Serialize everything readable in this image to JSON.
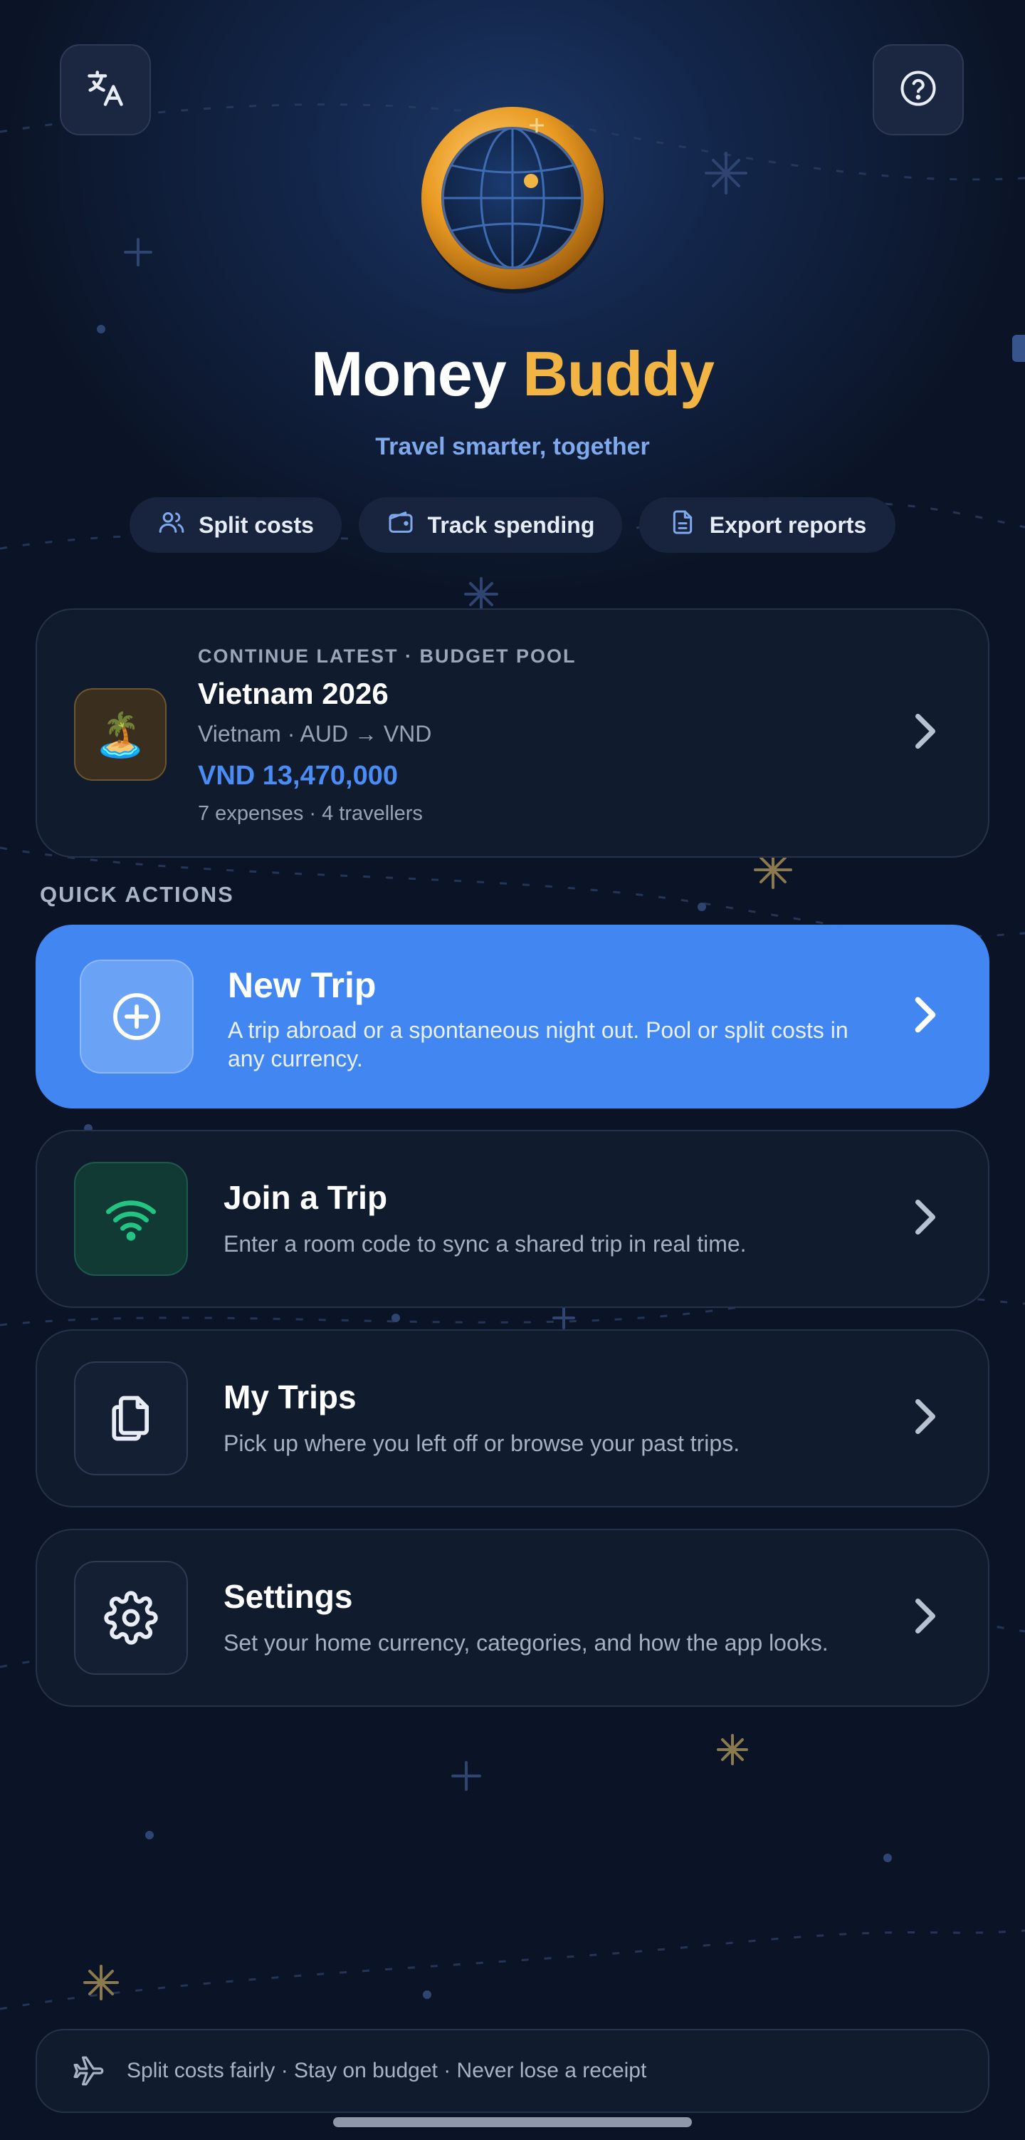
{
  "header": {
    "language_icon": "translate-icon",
    "help_icon": "help-circle-icon"
  },
  "brand": {
    "title_part1": "Money",
    "title_part2": "Buddy",
    "tagline": "Travel smarter, together",
    "logo_icon": "globe-coin-icon",
    "accent_color": "#f2b544"
  },
  "features": [
    {
      "label": "Split costs",
      "icon": "users-icon"
    },
    {
      "label": "Track spending",
      "icon": "wallet-icon"
    },
    {
      "label": "Export reports",
      "icon": "document-icon"
    }
  ],
  "continue_card": {
    "eyebrow": "CONTINUE LATEST · BUDGET POOL",
    "title": "Vietnam 2026",
    "route": "Vietnam · AUD → VND",
    "amount": "VND 13,470,000",
    "meta": "7 expenses · 4 travellers",
    "thumb_emoji": "🏝️",
    "amount_color": "#4b8cf4"
  },
  "quick_actions": {
    "label": "QUICK ACTIONS",
    "items": [
      {
        "title": "New Trip",
        "desc": "A trip abroad or a spontaneous night out. Pool or split costs in any currency.",
        "icon": "plus-circle-icon"
      },
      {
        "title": "Join a Trip",
        "desc": "Enter a room code to sync a shared trip in real time.",
        "icon": "wifi-icon"
      },
      {
        "title": "My Trips",
        "desc": "Pick up where you left off or browse your past trips.",
        "icon": "copy-documents-icon"
      },
      {
        "title": "Settings",
        "desc": "Set your home currency, categories, and how the app looks.",
        "icon": "gear-icon"
      }
    ]
  },
  "footer": {
    "text": "Split costs fairly · Stay on budget · Never lose a receipt",
    "icon": "airplane-icon"
  },
  "colors": {
    "primary": "#4286f2",
    "background": "#0b1426",
    "card": "#111b2e",
    "join_green": "#23c483"
  }
}
